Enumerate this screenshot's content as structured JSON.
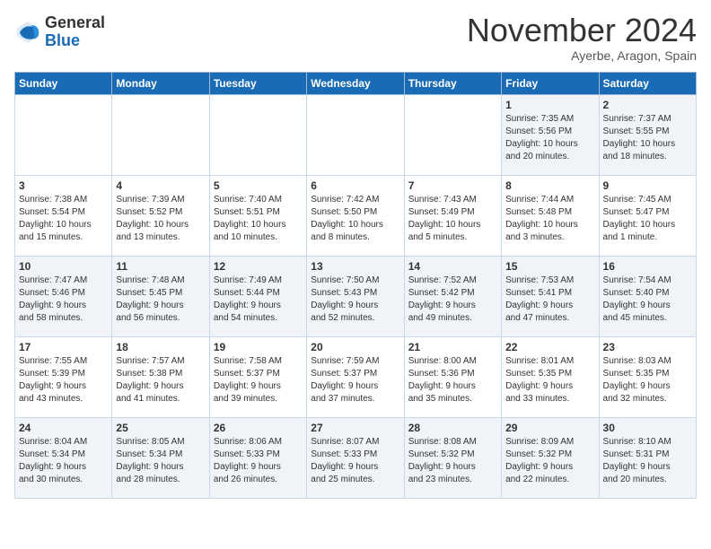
{
  "logo": {
    "general": "General",
    "blue": "Blue"
  },
  "header": {
    "month": "November 2024",
    "location": "Ayerbe, Aragon, Spain"
  },
  "weekdays": [
    "Sunday",
    "Monday",
    "Tuesday",
    "Wednesday",
    "Thursday",
    "Friday",
    "Saturday"
  ],
  "weeks": [
    [
      {
        "day": "",
        "info": ""
      },
      {
        "day": "",
        "info": ""
      },
      {
        "day": "",
        "info": ""
      },
      {
        "day": "",
        "info": ""
      },
      {
        "day": "",
        "info": ""
      },
      {
        "day": "1",
        "info": "Sunrise: 7:35 AM\nSunset: 5:56 PM\nDaylight: 10 hours\nand 20 minutes."
      },
      {
        "day": "2",
        "info": "Sunrise: 7:37 AM\nSunset: 5:55 PM\nDaylight: 10 hours\nand 18 minutes."
      }
    ],
    [
      {
        "day": "3",
        "info": "Sunrise: 7:38 AM\nSunset: 5:54 PM\nDaylight: 10 hours\nand 15 minutes."
      },
      {
        "day": "4",
        "info": "Sunrise: 7:39 AM\nSunset: 5:52 PM\nDaylight: 10 hours\nand 13 minutes."
      },
      {
        "day": "5",
        "info": "Sunrise: 7:40 AM\nSunset: 5:51 PM\nDaylight: 10 hours\nand 10 minutes."
      },
      {
        "day": "6",
        "info": "Sunrise: 7:42 AM\nSunset: 5:50 PM\nDaylight: 10 hours\nand 8 minutes."
      },
      {
        "day": "7",
        "info": "Sunrise: 7:43 AM\nSunset: 5:49 PM\nDaylight: 10 hours\nand 5 minutes."
      },
      {
        "day": "8",
        "info": "Sunrise: 7:44 AM\nSunset: 5:48 PM\nDaylight: 10 hours\nand 3 minutes."
      },
      {
        "day": "9",
        "info": "Sunrise: 7:45 AM\nSunset: 5:47 PM\nDaylight: 10 hours\nand 1 minute."
      }
    ],
    [
      {
        "day": "10",
        "info": "Sunrise: 7:47 AM\nSunset: 5:46 PM\nDaylight: 9 hours\nand 58 minutes."
      },
      {
        "day": "11",
        "info": "Sunrise: 7:48 AM\nSunset: 5:45 PM\nDaylight: 9 hours\nand 56 minutes."
      },
      {
        "day": "12",
        "info": "Sunrise: 7:49 AM\nSunset: 5:44 PM\nDaylight: 9 hours\nand 54 minutes."
      },
      {
        "day": "13",
        "info": "Sunrise: 7:50 AM\nSunset: 5:43 PM\nDaylight: 9 hours\nand 52 minutes."
      },
      {
        "day": "14",
        "info": "Sunrise: 7:52 AM\nSunset: 5:42 PM\nDaylight: 9 hours\nand 49 minutes."
      },
      {
        "day": "15",
        "info": "Sunrise: 7:53 AM\nSunset: 5:41 PM\nDaylight: 9 hours\nand 47 minutes."
      },
      {
        "day": "16",
        "info": "Sunrise: 7:54 AM\nSunset: 5:40 PM\nDaylight: 9 hours\nand 45 minutes."
      }
    ],
    [
      {
        "day": "17",
        "info": "Sunrise: 7:55 AM\nSunset: 5:39 PM\nDaylight: 9 hours\nand 43 minutes."
      },
      {
        "day": "18",
        "info": "Sunrise: 7:57 AM\nSunset: 5:38 PM\nDaylight: 9 hours\nand 41 minutes."
      },
      {
        "day": "19",
        "info": "Sunrise: 7:58 AM\nSunset: 5:37 PM\nDaylight: 9 hours\nand 39 minutes."
      },
      {
        "day": "20",
        "info": "Sunrise: 7:59 AM\nSunset: 5:37 PM\nDaylight: 9 hours\nand 37 minutes."
      },
      {
        "day": "21",
        "info": "Sunrise: 8:00 AM\nSunset: 5:36 PM\nDaylight: 9 hours\nand 35 minutes."
      },
      {
        "day": "22",
        "info": "Sunrise: 8:01 AM\nSunset: 5:35 PM\nDaylight: 9 hours\nand 33 minutes."
      },
      {
        "day": "23",
        "info": "Sunrise: 8:03 AM\nSunset: 5:35 PM\nDaylight: 9 hours\nand 32 minutes."
      }
    ],
    [
      {
        "day": "24",
        "info": "Sunrise: 8:04 AM\nSunset: 5:34 PM\nDaylight: 9 hours\nand 30 minutes."
      },
      {
        "day": "25",
        "info": "Sunrise: 8:05 AM\nSunset: 5:34 PM\nDaylight: 9 hours\nand 28 minutes."
      },
      {
        "day": "26",
        "info": "Sunrise: 8:06 AM\nSunset: 5:33 PM\nDaylight: 9 hours\nand 26 minutes."
      },
      {
        "day": "27",
        "info": "Sunrise: 8:07 AM\nSunset: 5:33 PM\nDaylight: 9 hours\nand 25 minutes."
      },
      {
        "day": "28",
        "info": "Sunrise: 8:08 AM\nSunset: 5:32 PM\nDaylight: 9 hours\nand 23 minutes."
      },
      {
        "day": "29",
        "info": "Sunrise: 8:09 AM\nSunset: 5:32 PM\nDaylight: 9 hours\nand 22 minutes."
      },
      {
        "day": "30",
        "info": "Sunrise: 8:10 AM\nSunset: 5:31 PM\nDaylight: 9 hours\nand 20 minutes."
      }
    ]
  ]
}
